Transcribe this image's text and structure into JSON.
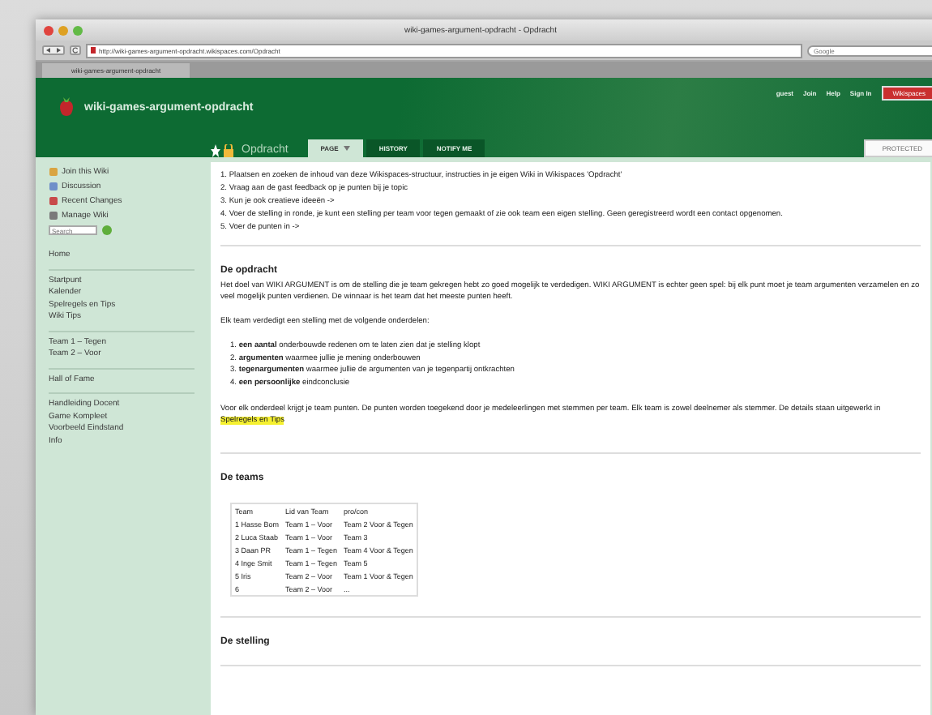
{
  "window": {
    "title": "wiki-games-argument-opdracht - Opdracht"
  },
  "toolbar": {
    "url": "http://wiki-games-argument-opdracht.wikispaces.com/Opdracht",
    "search_placeholder": "Google"
  },
  "tabs": [
    {
      "label": "wiki-games-argument-opdracht"
    }
  ],
  "header": {
    "site_name": "wiki-games-argument-opdracht",
    "user_links": [
      "guest",
      "Join",
      "Help",
      "Sign In"
    ],
    "brand_button": "Wikispaces"
  },
  "page_bar": {
    "title": "Opdracht",
    "tabs": [
      {
        "label": "PAGE",
        "selected": true
      },
      {
        "label": "HISTORY",
        "selected": false
      },
      {
        "label": "NOTIFY ME",
        "selected": false
      }
    ],
    "status": "PROTECTED"
  },
  "sidebar": {
    "actions": [
      {
        "label": "Join this Wiki",
        "kind": "join"
      },
      {
        "label": "Discussion",
        "kind": "discussion"
      },
      {
        "label": "Recent Changes",
        "kind": "changes"
      },
      {
        "label": "Manage Wiki",
        "kind": "manage"
      }
    ],
    "search_placeholder": "Search",
    "groups": [
      [
        "Home"
      ],
      [
        "Startpunt",
        "Kalender",
        "Spelregels en Tips",
        "Wiki Tips"
      ],
      [
        "Team 1 – Tegen",
        "Team 2 – Voor"
      ],
      [
        "Hall of Fame"
      ],
      [
        "Handleiding Docent",
        "Game Kompleet",
        "Voorbeeld Eindstand",
        "Info"
      ]
    ]
  },
  "content": {
    "steps": [
      "1. Plaatsen en zoeken de inhoud van deze Wikispaces-structuur, instructies in je eigen Wiki in Wikispaces 'Opdracht'",
      "2. Vraag aan de gast feedback op je punten bij je topic",
      "3. Kun je ook creatieve ideeën ->",
      "4. Voer de stelling in ronde, je kunt een stelling per team voor tegen gemaakt of zie ook team een eigen stelling. Geen geregistreerd wordt een contact opgenomen.",
      "5. Voer de punten in ->"
    ],
    "sections": [
      {
        "heading": "De opdracht",
        "paragraphs": [
          "Het doel van WIKI ARGUMENT is om de stelling die je team gekregen hebt zo goed mogelijk te verdedigen. WIKI ARGUMENT is echter geen spel: bij elk punt moet je team argumenten verzamelen en zo veel mogelijk punten verdienen. De winnaar is het team dat het meeste punten heeft.",
          "Elk team verdedigt een stelling met de volgende onderdelen:"
        ],
        "list": [
          "1. **een aantal** onderbouwde redenen om te laten zien dat je stelling klopt",
          "2. **argumenten** waarmee jullie je mening onderbouwen",
          "3. **tegenargumenten** waarmee jullie de argumenten van je tegenpartij ontkrachten",
          "4. **een persoonlijke** eindconclusie"
        ],
        "closing": "Voor elk onderdeel krijgt je team punten. De punten worden toegekend door je medeleerlingen met stemmen per team. Elk team is zowel deelnemer als stemmer. De details staan uitgewerkt in ",
        "closing_link": "Spelregels en Tips"
      },
      {
        "heading": "De teams",
        "table": {
          "columns": [
            "Team",
            "Lid van Team",
            "pro/con"
          ],
          "rows": [
            [
              "1 Hasse Bom",
              "Team 1 – Voor",
              "Team 2 Voor & Tegen"
            ],
            [
              "2 Luca Staab",
              "Team 1 – Voor",
              "Team 3"
            ],
            [
              "3 Daan PR",
              "Team 1 – Tegen",
              "Team 4 Voor & Tegen"
            ],
            [
              "4 Inge Smit",
              "Team 1 – Tegen",
              "Team 5"
            ],
            [
              "5 Iris",
              "Team 2 – Voor",
              "Team 1 Voor & Tegen"
            ],
            [
              "6",
              "Team 2 – Voor",
              "..."
            ]
          ]
        }
      },
      {
        "heading": "De stelling"
      }
    ]
  }
}
